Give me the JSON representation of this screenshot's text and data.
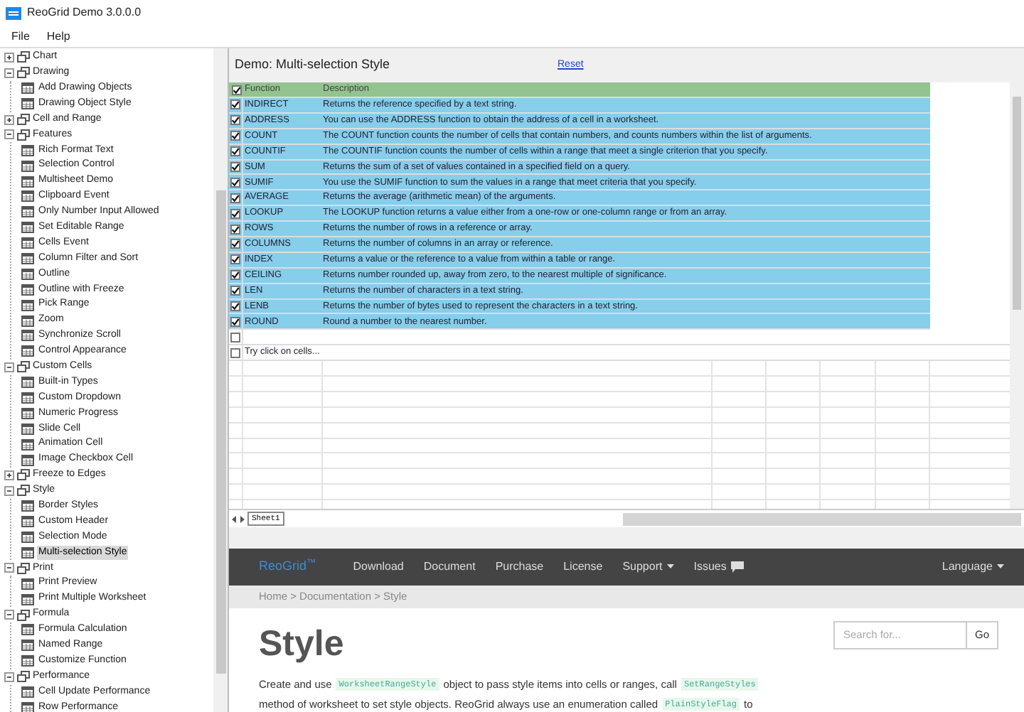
{
  "window": {
    "title": "ReoGrid Demo 3.0.0.0"
  },
  "menu": [
    {
      "label": "File"
    },
    {
      "label": "Help"
    }
  ],
  "tree": [
    {
      "label": "Chart",
      "expanded": false
    },
    {
      "label": "Drawing",
      "expanded": true,
      "children": [
        {
          "label": "Add Drawing Objects",
          "selected": false
        },
        {
          "label": "Drawing Object Style",
          "selected": false
        }
      ]
    },
    {
      "label": "Cell and Range",
      "expanded": false
    },
    {
      "label": "Features",
      "expanded": true,
      "children": [
        {
          "label": "Rich Format Text",
          "selected": false
        },
        {
          "label": "Selection Control",
          "selected": false
        },
        {
          "label": "Multisheet Demo",
          "selected": false
        },
        {
          "label": "Clipboard Event",
          "selected": false
        },
        {
          "label": "Only Number Input Allowed",
          "selected": false
        },
        {
          "label": "Set Editable Range",
          "selected": false
        },
        {
          "label": "Cells Event",
          "selected": false
        },
        {
          "label": "Column Filter and Sort",
          "selected": false
        },
        {
          "label": "Outline",
          "selected": false
        },
        {
          "label": "Outline with Freeze",
          "selected": false
        },
        {
          "label": "Pick Range",
          "selected": false
        },
        {
          "label": "Zoom",
          "selected": false
        },
        {
          "label": "Synchronize Scroll",
          "selected": false
        },
        {
          "label": "Control Appearance",
          "selected": false
        }
      ]
    },
    {
      "label": "Custom Cells",
      "expanded": true,
      "children": [
        {
          "label": "Built-in Types",
          "selected": false
        },
        {
          "label": "Custom Dropdown",
          "selected": false
        },
        {
          "label": "Numeric Progress",
          "selected": false
        },
        {
          "label": "Slide Cell",
          "selected": false
        },
        {
          "label": "Animation Cell",
          "selected": false
        },
        {
          "label": "Image Checkbox Cell",
          "selected": false
        }
      ]
    },
    {
      "label": "Freeze to Edges",
      "expanded": false
    },
    {
      "label": "Style",
      "expanded": true,
      "children": [
        {
          "label": "Border Styles",
          "selected": false
        },
        {
          "label": "Custom Header",
          "selected": false
        },
        {
          "label": "Selection Mode",
          "selected": false
        },
        {
          "label": "Multi-selection Style",
          "selected": true
        }
      ]
    },
    {
      "label": "Print",
      "expanded": true,
      "children": [
        {
          "label": "Print Preview",
          "selected": false
        },
        {
          "label": "Print Multiple Worksheet",
          "selected": false
        }
      ]
    },
    {
      "label": "Formula",
      "expanded": true,
      "children": [
        {
          "label": "Formula Calculation",
          "selected": false
        },
        {
          "label": "Named Range",
          "selected": false
        },
        {
          "label": "Customize Function",
          "selected": false
        }
      ]
    },
    {
      "label": "Performance",
      "expanded": true,
      "children": [
        {
          "label": "Cell Update Performance",
          "selected": false
        },
        {
          "label": "Row Performance",
          "selected": false
        }
      ]
    }
  ],
  "demo": {
    "title": "Demo: Multi-selection Style",
    "reset_link": "Reset"
  },
  "grid": {
    "header": {
      "checked": true,
      "columns": [
        "Function",
        "Description"
      ]
    },
    "rows": [
      {
        "checked": true,
        "function": "INDIRECT",
        "description": "Returns the reference specified by a text string."
      },
      {
        "checked": true,
        "function": "ADDRESS",
        "description": "You can use the ADDRESS function to obtain the address of a cell in a worksheet."
      },
      {
        "checked": true,
        "function": "COUNT",
        "description": "The COUNT function counts the number of cells that contain numbers, and counts numbers within the list of arguments."
      },
      {
        "checked": true,
        "function": "COUNTIF",
        "description": "The COUNTIF function counts the number of cells within a range that meet a single criterion that you specify."
      },
      {
        "checked": true,
        "function": "SUM",
        "description": "Returns the sum of a set of values contained in a specified field on a query."
      },
      {
        "checked": true,
        "function": "SUMIF",
        "description": "You use the SUMIF function to sum the values in a range that meet criteria that you specify."
      },
      {
        "checked": true,
        "function": "AVERAGE",
        "description": "Returns the average (arithmetic mean) of the arguments."
      },
      {
        "checked": true,
        "function": "LOOKUP",
        "description": "The LOOKUP function returns a value either from a one-row or one-column range or from an array."
      },
      {
        "checked": true,
        "function": "ROWS",
        "description": "Returns the number of rows in a reference or array."
      },
      {
        "checked": true,
        "function": "COLUMNS",
        "description": "Returns the number of columns in an array or reference."
      },
      {
        "checked": true,
        "function": "INDEX",
        "description": "Returns a value or the reference to a value from within a table or range."
      },
      {
        "checked": true,
        "function": "CEILING",
        "description": "Returns number rounded up, away from zero, to the nearest multiple of significance."
      },
      {
        "checked": true,
        "function": "LEN",
        "description": "Returns the number of characters in a text string."
      },
      {
        "checked": true,
        "function": "LENB",
        "description": "Returns the number of bytes used to represent the characters in a text string."
      },
      {
        "checked": true,
        "function": "ROUND",
        "description": "Round a number to the nearest number."
      },
      {
        "checked": false
      },
      {
        "checked": false,
        "function": "Try click on cells..."
      }
    ]
  },
  "sheet_tabs": [
    {
      "label": "Sheet1",
      "selected": true
    }
  ],
  "web": {
    "logo": "ReoGrid$^{™}$",
    "nav": [
      {
        "label": "Download",
        "kind": "link"
      },
      {
        "label": "Document",
        "kind": "link"
      },
      {
        "label": "Purchase",
        "kind": "link"
      },
      {
        "label": "License",
        "kind": "link"
      },
      {
        "label": "Support",
        "kind": "dropdown"
      },
      {
        "label": "Issues",
        "kind": "chat"
      }
    ],
    "language": "Language",
    "breadcrumb": "Home > Documentation > Style",
    "heading": "Style",
    "search": {
      "placeholder": "Search for...",
      "button": "Go"
    },
    "paragraph": [
      [
        {
          "kind": "text",
          "text": "Create and use"
        },
        {
          "kind": "code",
          "text": "WorksheetRangeStyle"
        },
        {
          "kind": "text",
          "text": "object to pass style items into cells or ranges, call"
        },
        {
          "kind": "code",
          "text": "SetRangeStyles"
        }
      ],
      [
        {
          "kind": "text",
          "text": "method of worksheet to set style objects. ReoGrid always use an enumeration called"
        },
        {
          "kind": "code",
          "text": "PlainStyleFlag"
        },
        {
          "kind": "text",
          "text": "to"
        }
      ]
    ]
  }
}
